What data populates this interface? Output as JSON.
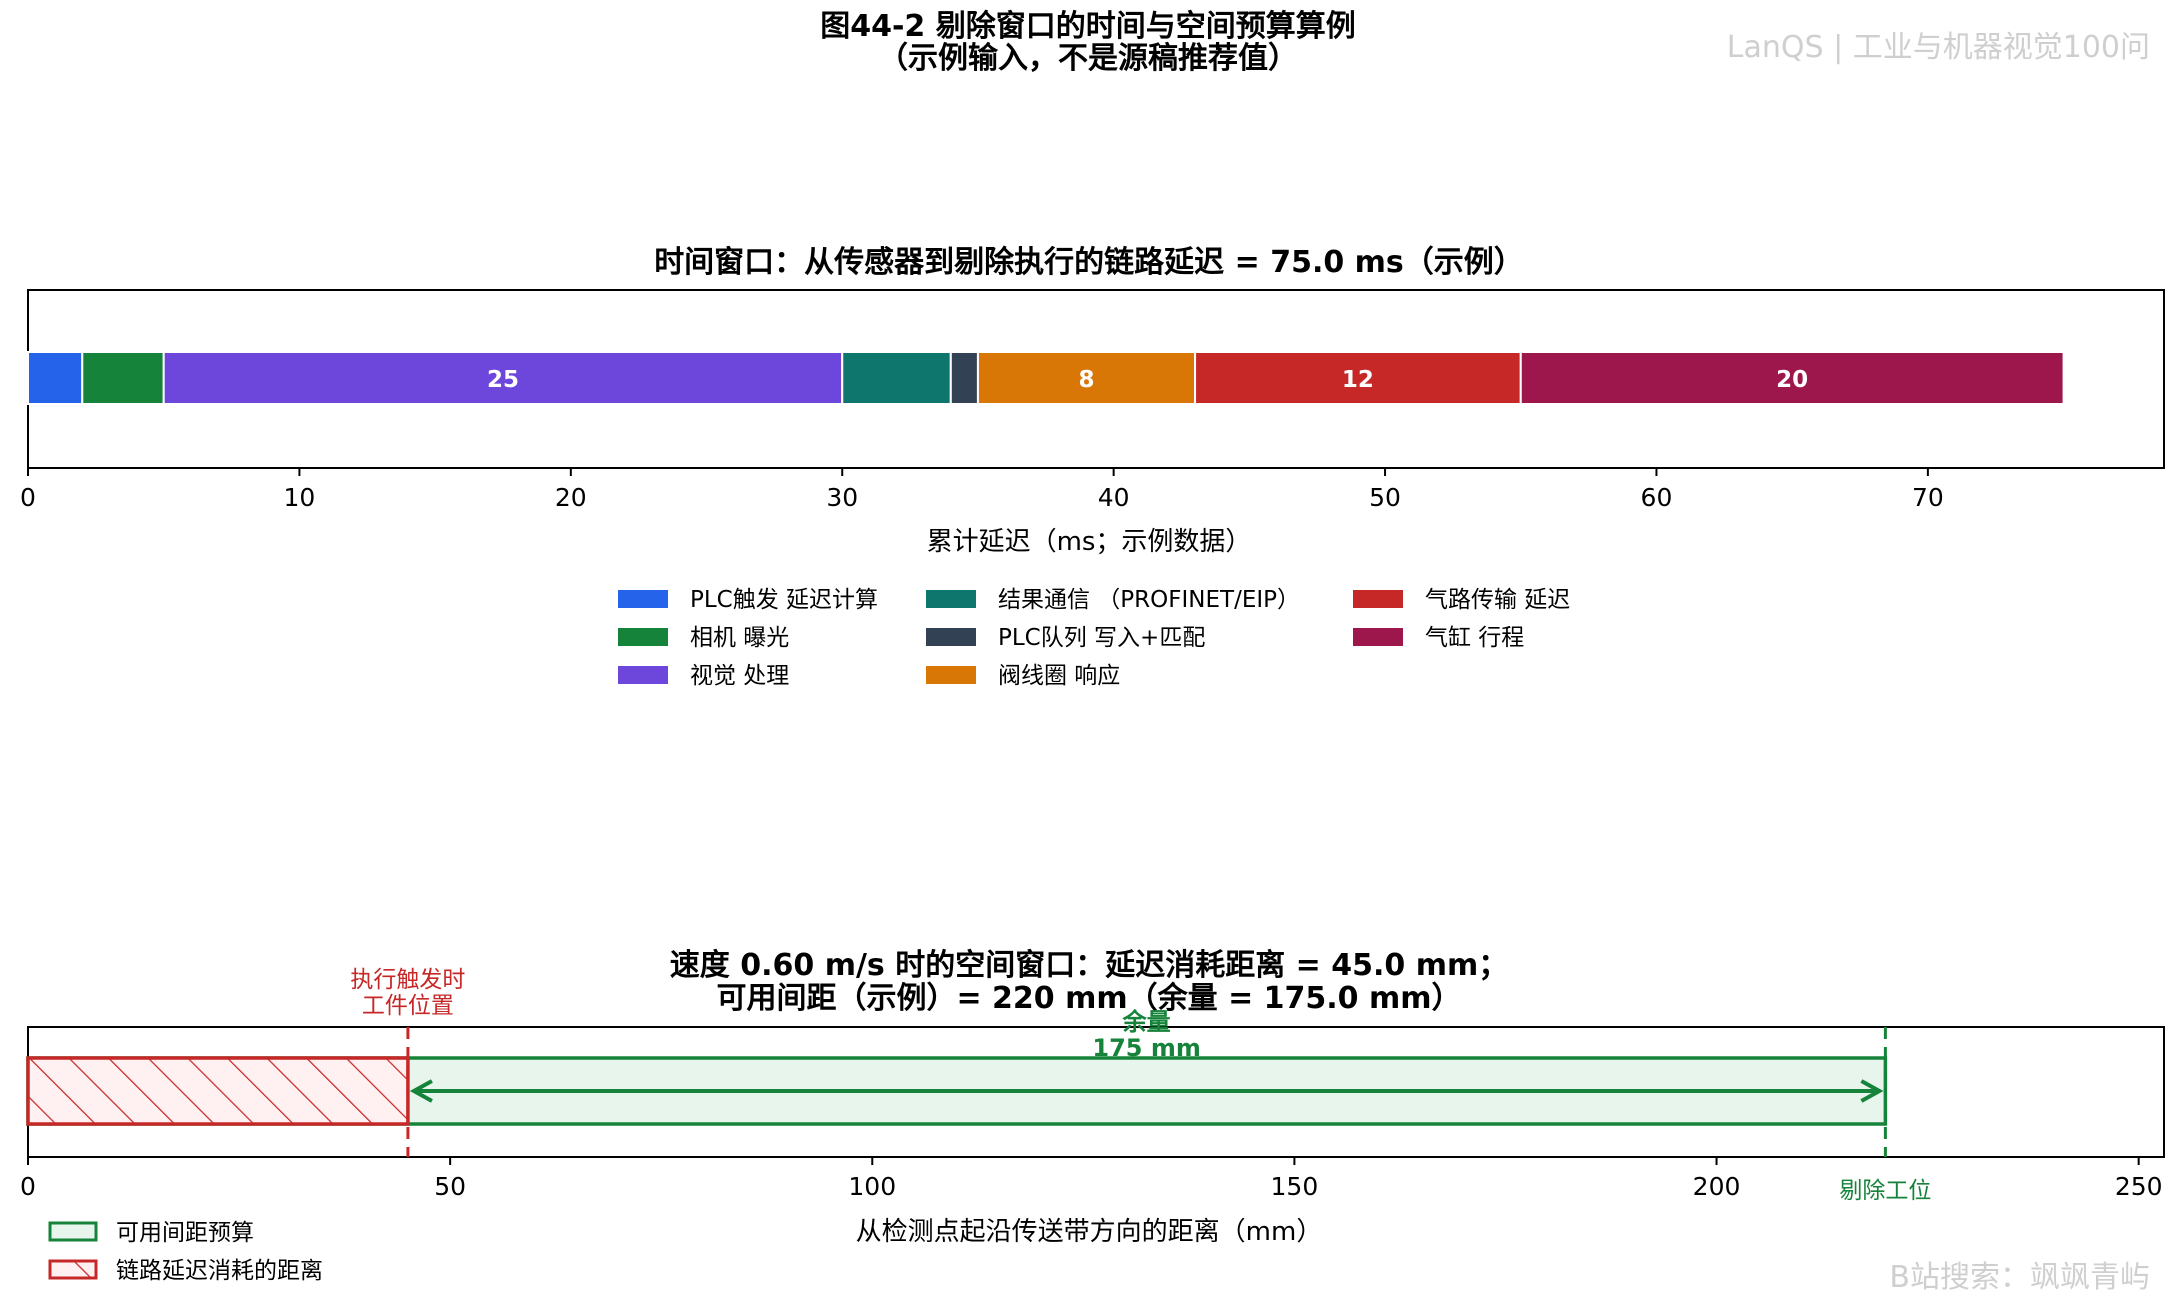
{
  "figure": {
    "title_line1": "图44-2 剔除窗口的时间与空间预算算例",
    "title_line2": "（示例输入，不是源稿推荐值）",
    "watermark_top": "LanQS | 工业与机器视觉100问",
    "watermark_bottom": "B站搜索：飒飒青屿"
  },
  "chart_data": [
    {
      "type": "bar",
      "orientation": "horizontal-stacked",
      "title": "时间窗口：从传感器到剔除执行的链路延迟 = 75.0 ms（示例）",
      "xlabel": "累计延迟（ms；示例数据）",
      "xlim": [
        0,
        78.7
      ],
      "xticks": [
        0,
        10,
        20,
        30,
        40,
        50,
        60,
        70
      ],
      "legend_placement": "bottom-center",
      "series": [
        {
          "name": "PLC触发 延迟计算",
          "value": 2,
          "color": "#2563eb",
          "label": ""
        },
        {
          "name": "相机 曝光",
          "value": 3,
          "color": "#16833a",
          "label": ""
        },
        {
          "name": "视觉 处理",
          "value": 25,
          "color": "#6d46db",
          "label": "25"
        },
        {
          "name": "结果通信 （PROFINET/EIP）",
          "value": 4,
          "color": "#0f766e",
          "label": ""
        },
        {
          "name": "PLC队列 写入+匹配",
          "value": 1,
          "color": "#334155",
          "label": ""
        },
        {
          "name": "阀线圈 响应",
          "value": 8,
          "color": "#d97706",
          "label": "8"
        },
        {
          "name": "气路传输 延迟",
          "value": 12,
          "color": "#c62828",
          "label": "12"
        },
        {
          "name": "气缸 行程",
          "value": 20,
          "color": "#9d174d",
          "label": "20"
        }
      ]
    },
    {
      "type": "bar",
      "orientation": "horizontal-spans",
      "title_line1": "速度 0.60 m/s 时的空间窗口：延迟消耗距离 = 45.0 mm；",
      "title_line2": "可用间距（示例）= 220 mm（余量 = 175.0 mm）",
      "xlabel": "从检测点起沿传送带方向的距离（mm）",
      "xlim": [
        0,
        253
      ],
      "xticks": [
        0,
        50,
        100,
        150,
        200,
        250
      ],
      "legend_placement": "bottom-left",
      "available_budget": {
        "start": 0,
        "end": 220,
        "label": "可用间距预算",
        "color": "#16833a"
      },
      "delay_consumed": {
        "start": 0,
        "end": 45,
        "label": "链路延迟消耗的距离",
        "color": "#c62828"
      },
      "trigger_line": {
        "x": 45,
        "label_line1": "执行触发时",
        "label_line2": "工件位置",
        "color": "#c62828"
      },
      "reject_line": {
        "x": 220,
        "label": "剔除工位",
        "color": "#16833a"
      },
      "margin": {
        "from": 45,
        "to": 220,
        "label_line1": "余量",
        "label_line2": "175 mm"
      }
    }
  ]
}
